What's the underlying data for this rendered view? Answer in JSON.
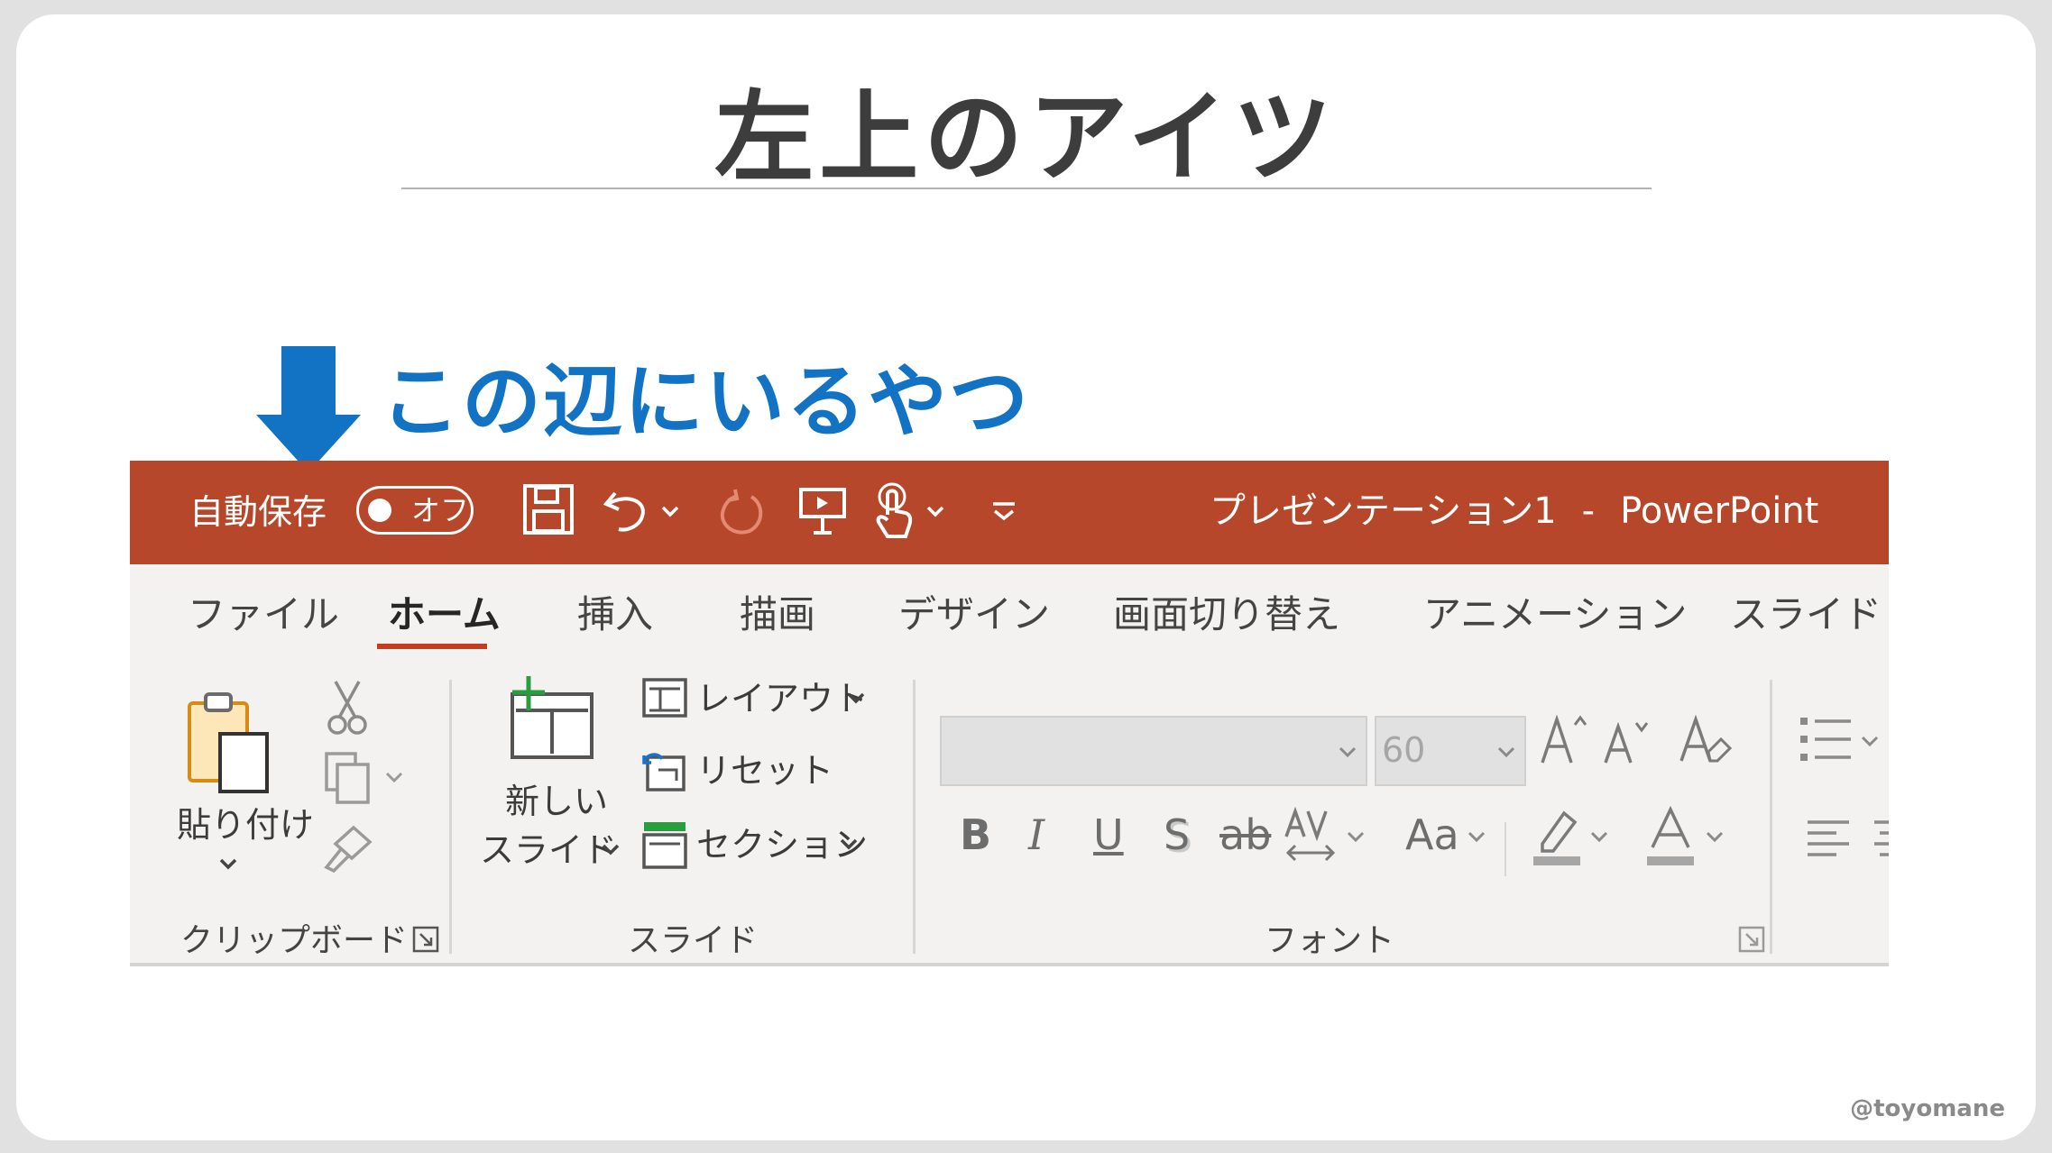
{
  "slide": {
    "title": "左上のアイツ",
    "callout": "この辺にいるやつ",
    "watermark": "@toyomane",
    "colors": {
      "callout": "#1272c3",
      "titlebar": "#b7472a",
      "active_tab_underline": "#c43e1c"
    }
  },
  "ppt": {
    "titlebar": {
      "autosave_label": "自動保存",
      "autosave_toggle": "オフ",
      "document_title": "プレゼンテーション1",
      "separator": "-",
      "app_name": "PowerPoint",
      "quick_access_icons": [
        "save-icon",
        "undo-icon",
        "redo-icon",
        "present-icon",
        "touch-mode-icon",
        "customize-qat-icon"
      ]
    },
    "tabs": [
      "ファイル",
      "ホーム",
      "挿入",
      "描画",
      "デザイン",
      "画面切り替え",
      "アニメーション",
      "スライド ショ"
    ],
    "active_tab": "ホーム",
    "ribbon": {
      "clipboard": {
        "paste_label_1": "貼り付け",
        "group_label": "クリップボード"
      },
      "slides": {
        "new_slide_1": "新しい",
        "new_slide_2": "スライド",
        "layout": "レイアウト",
        "reset": "リセット",
        "section": "セクション",
        "group_label": "スライド"
      },
      "font": {
        "font_name": "",
        "font_size": "60",
        "case_label": "Aa",
        "group_label": "フォント"
      }
    }
  }
}
